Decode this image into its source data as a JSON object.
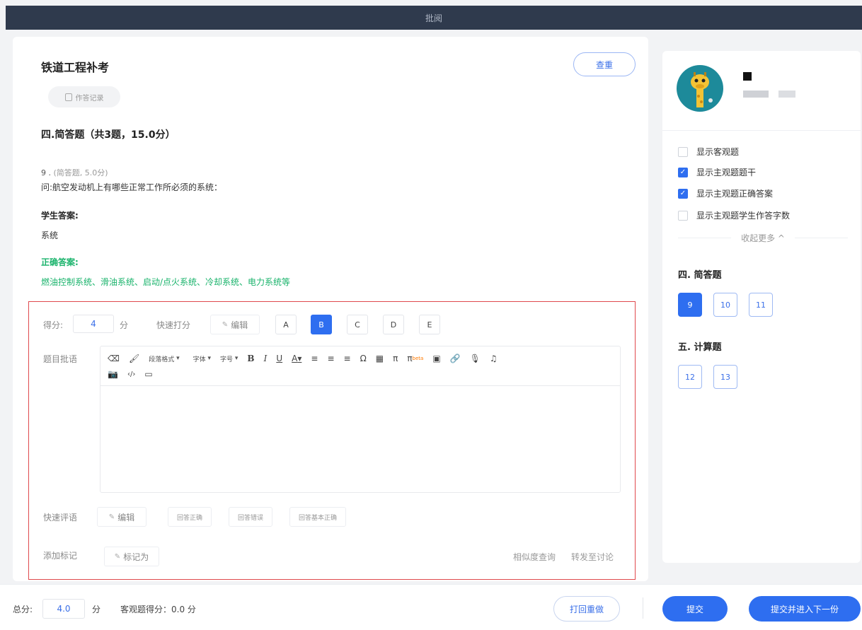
{
  "header": {
    "title": "批阅"
  },
  "exam": {
    "title": "铁道工程补考",
    "check_button": "查重",
    "record_chip": "作答记录"
  },
  "section": {
    "title": "四.简答题（共3题，15.0分）"
  },
  "question": {
    "number": "9 .",
    "meta": "(简答题, 5.0分)",
    "text": "问:航空发动机上有哪些正常工作所必须的系统：",
    "student_answer_label": "学生答案:",
    "student_answer": "系统",
    "correct_answer_label": "正确答案:",
    "correct_answer": "燃油控制系统、滑油系统、启动/点火系统、冷却系统、电力系统等"
  },
  "grading": {
    "score_label": "得分:",
    "score_value": "4",
    "score_unit": "分",
    "quick_score_label": "快速打分",
    "edit_label": "编辑",
    "grades": [
      "A",
      "B",
      "C",
      "D",
      "E"
    ],
    "selected_grade": "B",
    "comment_label": "题目批语",
    "quick_comment_label": "快速评语",
    "quick_comment_edit": "编辑",
    "quick_comments": [
      "回答正确",
      "回答错误",
      "回答基本正确"
    ],
    "add_mark_label": "添加标记",
    "mark_as": "标记为",
    "similarity_query": "相似度查询",
    "forward_discussion": "转发至讨论"
  },
  "toolbar": {
    "paragraph_format": "段落格式",
    "font": "字体",
    "font_size": "字号",
    "bold": "B",
    "italic": "I",
    "underline": "U",
    "font_color": "A",
    "omega": "Ω",
    "pi": "π",
    "pi_beta": "π",
    "beta": "beta",
    "code": "‹/›"
  },
  "sidebar": {
    "options": [
      {
        "label": "显示客观题",
        "checked": false
      },
      {
        "label": "显示主观题题干",
        "checked": true
      },
      {
        "label": "显示主观题正确答案",
        "checked": true
      },
      {
        "label": "显示主观题学生作答字数",
        "checked": false
      }
    ],
    "collapse_more": "收起更多 ^",
    "sections": [
      {
        "title": "四. 简答题",
        "questions": [
          "9",
          "10",
          "11"
        ],
        "active": "9"
      },
      {
        "title": "五. 计算题",
        "questions": [
          "12",
          "13"
        ]
      }
    ]
  },
  "footer": {
    "total_label": "总分:",
    "total_value": "4.0",
    "total_unit": "分",
    "objective_score": "客观题得分：0.0 分",
    "reject_button": "打回重做",
    "submit_button": "提交",
    "submit_next_button": "提交并进入下一份"
  },
  "colors": {
    "accent": "#2e6ef0",
    "header_bg": "#2f3a4d",
    "correct_green": "#19b36b",
    "grading_border": "#e0494d"
  }
}
